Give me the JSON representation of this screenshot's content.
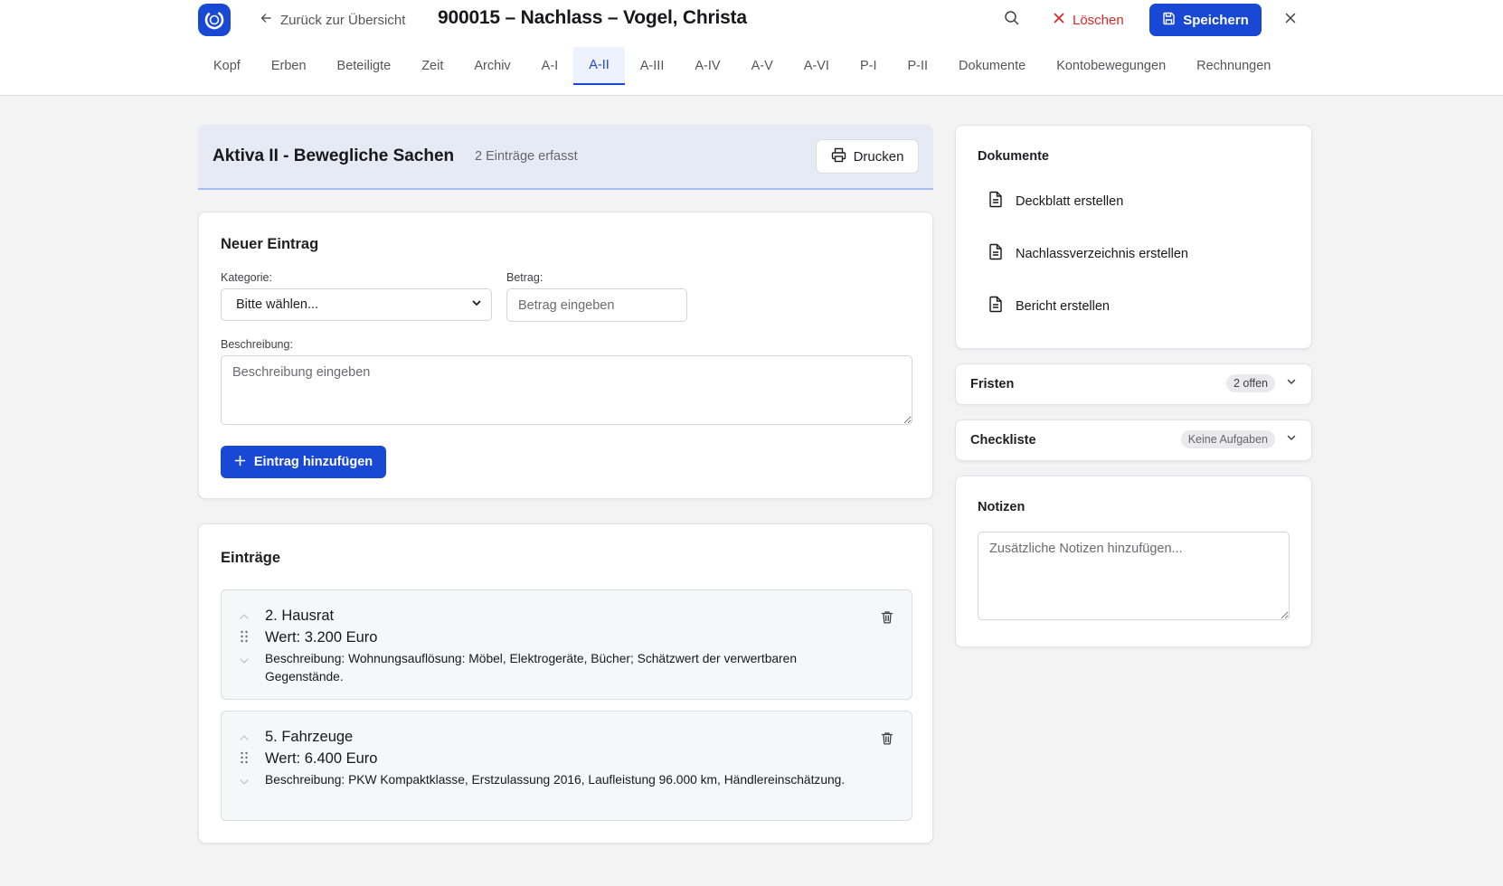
{
  "header": {
    "back_label": "Zurück zur Übersicht",
    "title": "900015 – Nachlass – Vogel, Christa",
    "delete_label": "Löschen",
    "save_label": "Speichern",
    "icons": [
      "logo-icon",
      "arrow-left-icon",
      "search-icon",
      "x-icon",
      "save-icon",
      "close-icon"
    ],
    "accent_color": "#1948d4",
    "danger_color": "#dc2626"
  },
  "tabs": [
    {
      "label": "Kopf"
    },
    {
      "label": "Erben"
    },
    {
      "label": "Beteiligte"
    },
    {
      "label": "Zeit"
    },
    {
      "label": "Archiv"
    },
    {
      "label": "A-I"
    },
    {
      "label": "A-II",
      "active": true
    },
    {
      "label": "A-III"
    },
    {
      "label": "A-IV"
    },
    {
      "label": "A-V"
    },
    {
      "label": "A-VI"
    },
    {
      "label": "P-I"
    },
    {
      "label": "P-II"
    },
    {
      "label": "Dokumente"
    },
    {
      "label": "Kontobewegungen"
    },
    {
      "label": "Rechnungen"
    }
  ],
  "section": {
    "title": "Aktiva II - Bewegliche Sachen",
    "count": "2 Einträge erfasst",
    "print_label": "Drucken"
  },
  "new_entry": {
    "title": "Neuer Eintrag",
    "category_label": "Kategorie:",
    "category_value": "Bitte wählen...",
    "amount_label": "Betrag:",
    "amount_placeholder": "Betrag eingeben",
    "description_label": "Beschreibung:",
    "description_placeholder": "Beschreibung eingeben",
    "add_label": "Eintrag hinzufügen"
  },
  "entries": {
    "title": "Einträge",
    "items": [
      {
        "name": "2. Hausrat",
        "value": "Wert: 3.200 Euro",
        "description_prefix": "Beschreibung:",
        "description": "Wohnungsauflösung: Möbel, Elektrogeräte, Bücher; Schätzwert der verwertbaren Gegenstände."
      },
      {
        "name": "5. Fahrzeuge",
        "value": "Wert: 6.400 Euro",
        "description_prefix": "Beschreibung:",
        "description": "PKW Kompaktklasse, Erstzulassung 2016, Laufleistung 96.000 km, Händlereinschätzung."
      }
    ]
  },
  "sidebar": {
    "documents": {
      "title": "Dokumente",
      "items": [
        {
          "label": "Deckblatt erstellen"
        },
        {
          "label": "Nachlassverzeichnis erstellen"
        },
        {
          "label": "Bericht erstellen"
        }
      ]
    },
    "deadlines": {
      "title": "Fristen",
      "badge": "2 offen"
    },
    "checklist": {
      "title": "Checkliste",
      "badge": "Keine Aufgaben"
    },
    "notes": {
      "title": "Notizen",
      "placeholder": "Zusätzliche Notizen hinzufügen..."
    }
  }
}
